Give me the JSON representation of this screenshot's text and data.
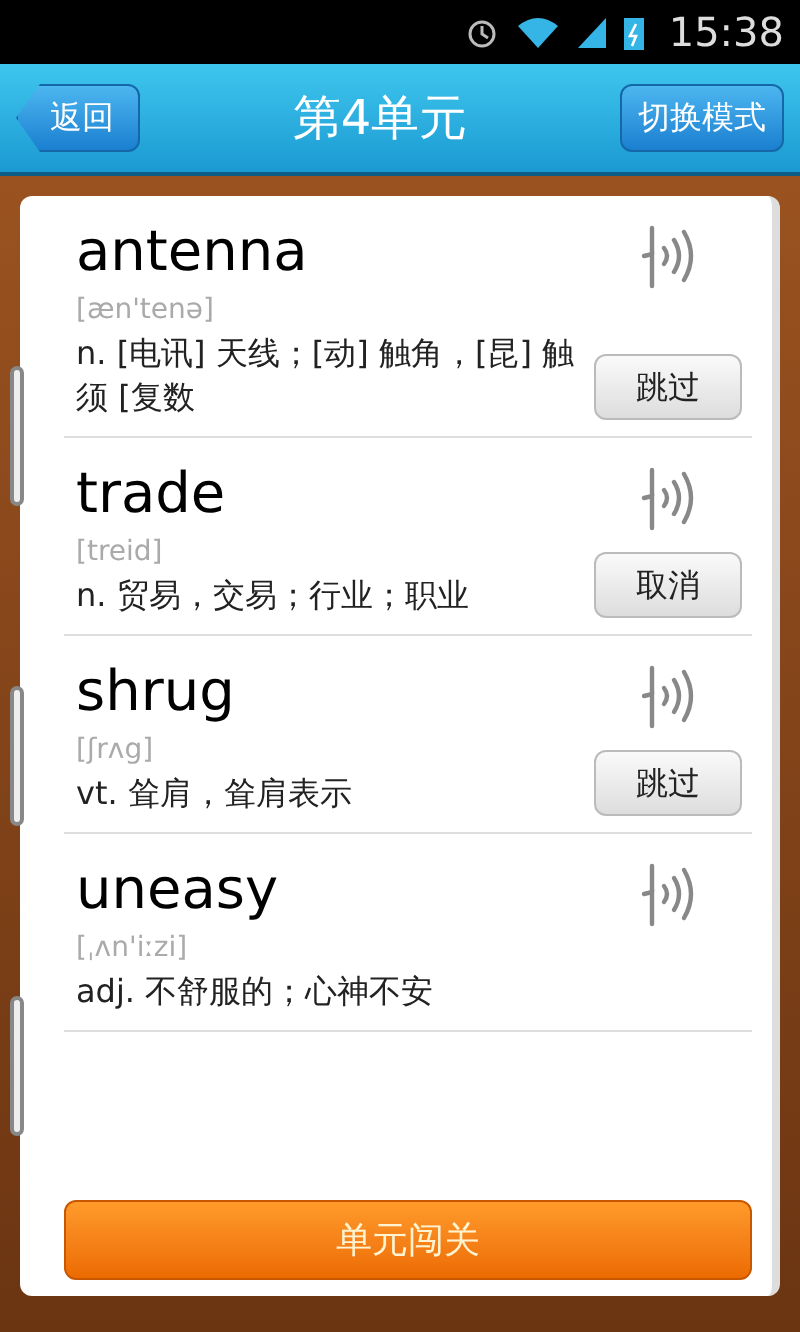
{
  "status_bar": {
    "time": "15:38"
  },
  "header": {
    "back": "返回",
    "title": "第4单元",
    "mode": "切换模式"
  },
  "words": [
    {
      "word": "antenna",
      "phonetic": "[æn'tenə]",
      "meaning": "n. [电讯] 天线；[动] 触角，[昆] 触须   [复数",
      "action": "跳过"
    },
    {
      "word": "trade",
      "phonetic": "[treid]",
      "meaning": "n. 贸易，交易；行业；职业",
      "action": "取消"
    },
    {
      "word": "shrug",
      "phonetic": "[ʃrʌg]",
      "meaning": "vt. 耸肩，耸肩表示",
      "action": "跳过"
    },
    {
      "word": "uneasy",
      "phonetic": "[ˌʌn'iːzi]",
      "meaning": "adj. 不舒服的；心神不安"
    }
  ],
  "submit": "单元闯关"
}
